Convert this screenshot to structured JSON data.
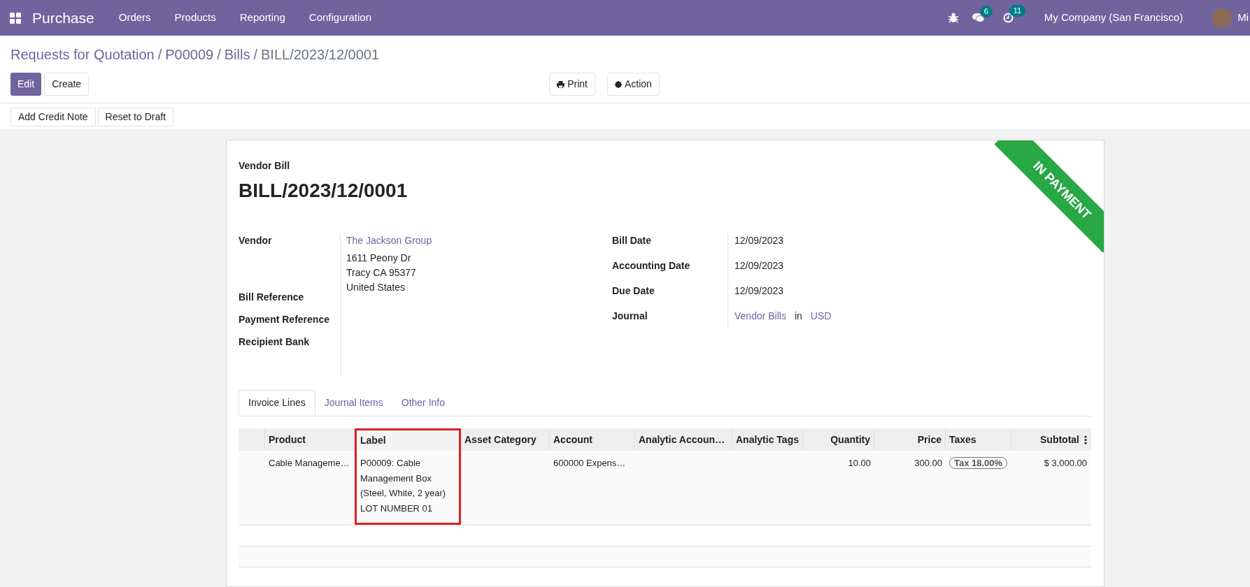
{
  "navbar": {
    "app_name": "Purchase",
    "menu": [
      "Orders",
      "Products",
      "Reporting",
      "Configuration"
    ],
    "messages_count": "6",
    "activities_count": "11",
    "company": "My Company (San Francisco)",
    "user": "Mi"
  },
  "breadcrumb": {
    "links": [
      {
        "label": "Requests for Quotation",
        "separator": "/"
      },
      {
        "label": "P00009",
        "separator": "/"
      },
      {
        "label": "Bills",
        "separator": "/"
      }
    ],
    "current": "BILL/2023/12/0001"
  },
  "buttons": {
    "edit": "Edit",
    "create": "Create",
    "print": "Print",
    "action": "Action"
  },
  "status_buttons": [
    "Add Credit Note",
    "Reset to Draft"
  ],
  "form": {
    "type_label": "Vendor Bill",
    "name": "BILL/2023/12/0001",
    "ribbon": "IN PAYMENT",
    "left_labels": [
      "Vendor",
      "Bill Reference",
      "Payment Reference",
      "Recipient Bank"
    ],
    "vendor": {
      "name": "The Jackson Group",
      "address": [
        "1611 Peony Dr",
        "Tracy CA 95377",
        "United States"
      ]
    },
    "right_fields": [
      {
        "label": "Bill Date",
        "value": "12/09/2023"
      },
      {
        "label": "Accounting Date",
        "value": "12/09/2023"
      },
      {
        "label": "Due Date",
        "value": "12/09/2023"
      }
    ],
    "journal": {
      "label": "Journal",
      "journal": "Vendor Bills",
      "connector": "in",
      "currency": "USD"
    }
  },
  "tabs": [
    {
      "label": "Invoice Lines",
      "selected": true
    },
    {
      "label": "Journal Items",
      "selected": false
    },
    {
      "label": "Other Info",
      "selected": false
    }
  ],
  "table": {
    "columns": [
      {
        "label": "Product",
        "highlighted": false
      },
      {
        "label": "Label",
        "highlighted": true
      },
      {
        "label": "Asset Category",
        "highlighted": false
      },
      {
        "label": "Account",
        "highlighted": false
      },
      {
        "label": "Analytic Accoun…",
        "highlighted": false
      },
      {
        "label": "Analytic Tags",
        "highlighted": false
      },
      {
        "label": "Quantity",
        "highlighted": false
      },
      {
        "label": "Price",
        "highlighted": false
      },
      {
        "label": "Taxes",
        "highlighted": false
      },
      {
        "label": "Subtotal",
        "highlighted": false
      }
    ],
    "rows": [
      {
        "cells": [
          "Cable Manageme…",
          "P00009: Cable Management Box (Steel, White, 2 year) LOT NUMBER 01",
          "",
          "600000 Expens…",
          "",
          "",
          "10.00",
          "300.00",
          "",
          "$ 3,000.00"
        ],
        "tax_tag": "Tax 18.00%"
      }
    ]
  }
}
